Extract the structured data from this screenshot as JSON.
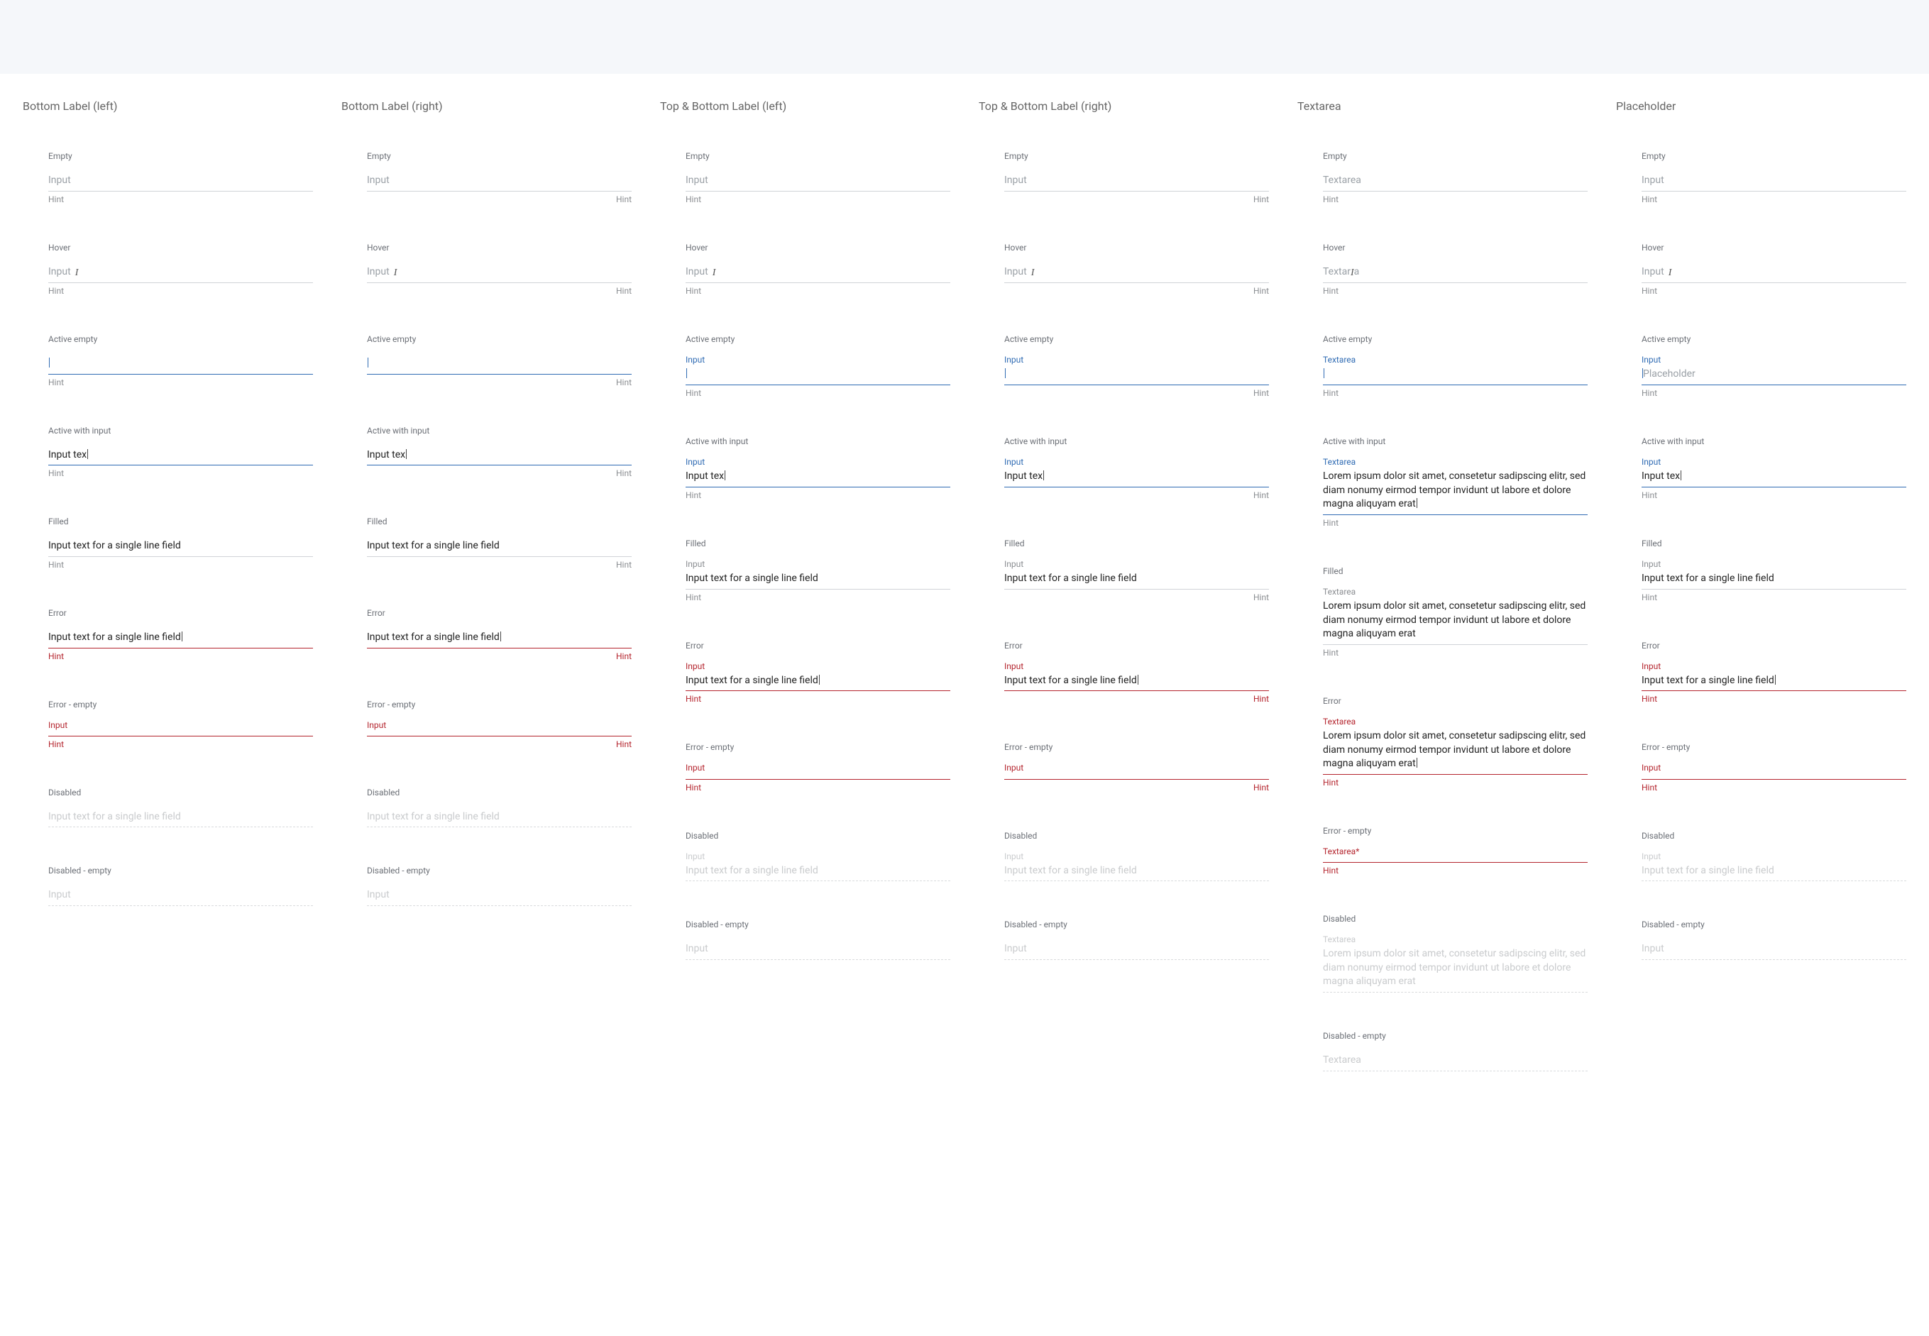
{
  "columns": {
    "c1": "Bottom Label (left)",
    "c2": "Bottom Label (right)",
    "c3": "Top & Bottom Label (left)",
    "c4": "Top & Bottom Label (right)",
    "c5": "Textarea",
    "c6": "Placeholder"
  },
  "states": {
    "empty": "Empty",
    "hover": "Hover",
    "active_empty": "Active empty",
    "active_input": "Active with input",
    "filled": "Filled",
    "error": "Error",
    "error_empty": "Error - empty",
    "disabled": "Disabled",
    "disabled_empty": "Disabled - empty"
  },
  "labels": {
    "input": "Input",
    "textarea": "Textarea",
    "textarea_req": "Textarea*",
    "hint": "Hint",
    "placeholder": "Placeholder"
  },
  "values": {
    "partial": "Input tex",
    "full": "Input text for a single line field",
    "lorem": "Lorem ipsum dolor sit amet, consetetur sadipscing elitr, sed diam nonumy eirmod tempor invidunt ut labore et dolore magna aliquyam erat"
  }
}
